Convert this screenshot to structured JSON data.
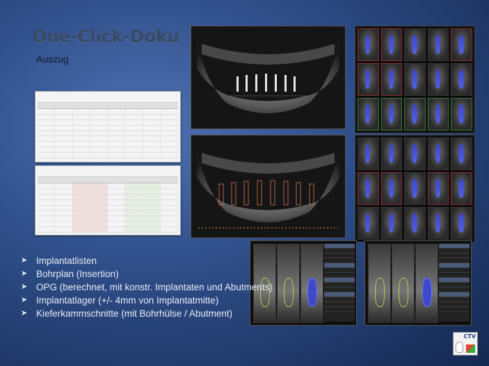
{
  "slide": {
    "title": "One-Click-Doku",
    "subtitle": "Auszug",
    "bullets": [
      "Implantatlisten",
      "Bohrplan (Insertion)",
      "OPG (berechnet, mit konstr. Implantaten und Abutments)",
      "Implantatlager (+/- 4mm von Implantatmitte)",
      "Kieferkammschnitte (mit Bohrhülse / Abutment)"
    ],
    "logo_text": "CTV"
  },
  "icons": {
    "bullet": "arrow-bullet-icon",
    "logo": "ctv-logo-icon"
  },
  "colors": {
    "implant_blue": "#3f48c7",
    "drill_yellow": "#b8d34a",
    "accent_red": "#8a3030",
    "accent_green": "#3a7a3a"
  }
}
